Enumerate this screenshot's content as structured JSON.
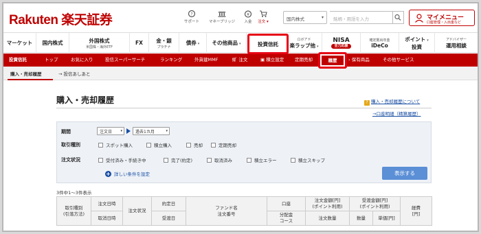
{
  "header": {
    "logo": "Rakuten 楽天証券",
    "icons": [
      {
        "label": "サポート",
        "icon": "support-icon"
      },
      {
        "label": "マネーブリッジ",
        "icon": "money-bridge-icon"
      },
      {
        "label": "入金",
        "icon": "deposit-icon"
      },
      {
        "label": "注文",
        "sub": "注文 ▾",
        "icon": "cart-icon"
      }
    ],
    "market_select": "国内株式",
    "search_placeholder": "銘柄・用語を入力",
    "mymenu_title": "マイメニュー",
    "mymenu_sub": "口座管理・入出金など"
  },
  "main_nav": [
    {
      "label": "マーケット"
    },
    {
      "label": "国内株式"
    },
    {
      "label": "外国株式",
      "sub": "米国株・海外ETF"
    },
    {
      "label": "FX"
    },
    {
      "label": "金・銀",
      "sub": "プラチナ"
    },
    {
      "label": "債券"
    },
    {
      "label": "その他商品"
    },
    {
      "label": "投資信託"
    },
    {
      "label": "楽ラップ他",
      "sub": "ロボアド"
    },
    {
      "label": "NISA",
      "pill": "全力応援"
    },
    {
      "label": "iDeCo",
      "sub": "確定拠出年金"
    },
    {
      "label": "ポイント",
      "sub2": "投資"
    },
    {
      "label": "アドバイザー",
      "sub2": "運用相談"
    }
  ],
  "sub_nav": [
    "投資信託",
    "トップ",
    "お気に入り",
    "投信スーパーサーチ",
    "ランキング",
    "外貨建MMF",
    "注文",
    "積立設定",
    "定期売却",
    "履歴",
    "保有商品",
    "その他サービス"
  ],
  "third_nav": [
    "購入・売却履歴",
    "投信あしあと"
  ],
  "page": {
    "title": "購入・売却履歴",
    "help_link": "購入・売却履歴について",
    "history_link": "→口座明細（精算履歴）"
  },
  "filter": {
    "period_label": "期間",
    "date_type": "注文日",
    "range": "過去1カ月",
    "trade_type_label": "取引種別",
    "trade_types": [
      "スポット購入",
      "積立購入",
      "売却",
      "定期売却"
    ],
    "status_label": "注文状況",
    "statuses": [
      "受付済み・手続き中",
      "完了(約定)",
      "取消済み",
      "積立エラー",
      "積立スキップ"
    ],
    "detail_link": "詳しい条件を設定",
    "submit": "表示する"
  },
  "result_count": "3件中1～3件表示",
  "table": {
    "h_trade_type": "取引種別",
    "h_trade_method": "(引落方法)",
    "h_order_date": "注文日時",
    "h_cancel_date": "取消日時",
    "h_order_status": "注文状況",
    "h_trade_date": "約定日",
    "h_settle_date": "受渡日",
    "h_fund_name": "ファンド名",
    "h_order_no": "注文番号",
    "h_account": "口座",
    "h_dist_course": "分配金",
    "h_dist_course2": "コース",
    "h_order_amount": "注文金額[円]",
    "h_order_amount_pt": "(ポイント利用)",
    "h_order_qty": "注文数量",
    "h_settle_amount": "受渡金額[円]",
    "h_settle_amount_pt": "(ポイント利用)",
    "h_qty": "数量",
    "h_unit_price": "単価[円]",
    "h_fee": "経費",
    "h_fee_unit": "[円]"
  }
}
